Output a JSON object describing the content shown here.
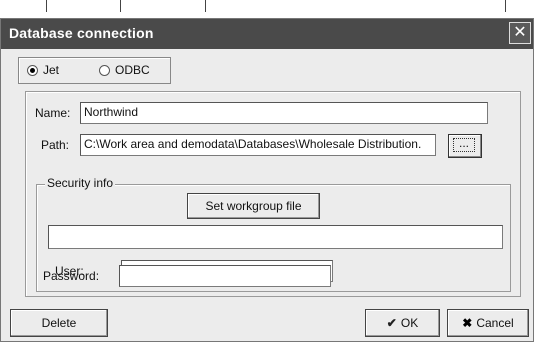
{
  "dialog": {
    "title": "Database connection",
    "close_glyph": "✕"
  },
  "connection_type": {
    "options": [
      {
        "label": "Jet",
        "selected": true
      },
      {
        "label": "ODBC",
        "selected": false
      }
    ]
  },
  "form": {
    "name_label": "Name:",
    "name_value": "Northwind",
    "path_label": "Path:",
    "path_value": "C:\\Work area and demodata\\Databases\\Wholesale Distribution.",
    "browse_label": "...",
    "security": {
      "legend": "Security info",
      "workgroup_button": "Set workgroup file",
      "workgroup_path": "",
      "user_label": "User:",
      "user_value": "",
      "password_label": "Password:",
      "password_value": ""
    }
  },
  "buttons": {
    "delete": "Delete",
    "ok": "OK",
    "cancel": "Cancel",
    "ok_icon": "check-icon",
    "cancel_icon": "x-icon"
  },
  "colors": {
    "titlebar": "#4a4a4a",
    "dialog_bg": "#ececec"
  }
}
